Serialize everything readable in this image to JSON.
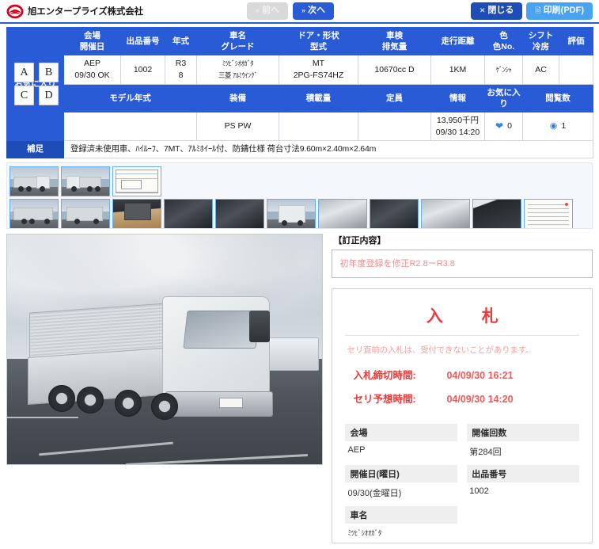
{
  "header": {
    "brand_name": "旭エンタープライズ株式会社",
    "logo_icon": "asahi-circle-logo",
    "prev_label": "前へ",
    "prev_glyph": "«",
    "next_label": "次へ",
    "next_glyph": "»",
    "close_label": "閉じる",
    "close_glyph": "✕",
    "print_label": "印刷(PDF)",
    "print_glyph": "🗎",
    "accent_blue": "#2a5bd7",
    "print_blue": "#4aa3f0"
  },
  "table": {
    "headers_row1": [
      "お気に入り",
      "会場\n開催日",
      "出品番号",
      "年式",
      "車名\nグレード",
      "ドア・形状\n型式",
      "車検\n排気量",
      "走行距離",
      "色\n色No.",
      "シフト\n冷房",
      "評価"
    ],
    "h_favorite": "お気に入り",
    "h_venue": "会場",
    "h_venue2": "開催日",
    "h_lot": "出品番号",
    "h_year": "年式",
    "h_name": "車名",
    "h_name2": "グレード",
    "h_door": "ドア・形状",
    "h_door2": "型式",
    "h_shaken": "車検",
    "h_shaken2": "排気量",
    "h_mileage": "走行距離",
    "h_color": "色",
    "h_color2": "色No.",
    "h_shift": "シフト",
    "h_shift2": "冷房",
    "h_rating": "評価",
    "fav_buttons": [
      "A",
      "B",
      "C",
      "D"
    ],
    "row1": {
      "venue": "AEP",
      "venue_date": "09/30 OK",
      "lot_no": "1002",
      "year": "R3",
      "year2": "8",
      "car_name": "ﾐﾂﾋﾞｼｵｵｶﾞﾀ",
      "grade": "三菱 ｱﾙﾐｳｲﾝｸﾞ",
      "door": "MT",
      "model_code": "2PG-FS74HZ",
      "displacement": "10670cc D",
      "mileage": "1KM",
      "color": "ｹﾞﾝｼｬ",
      "shift_ac": "AC",
      "rating": ""
    },
    "headers_row2": [
      "モデル年式",
      "装備",
      "積載量",
      "定員",
      "情報",
      "お気に入り",
      "閲覧数"
    ],
    "h_model_year": "モデル年式",
    "h_equipment": "装備",
    "h_capacity": "積載量",
    "h_seats": "定員",
    "h_info": "情報",
    "h_fav2": "お気に入り",
    "h_views": "閲覧数",
    "row2": {
      "model_year": "",
      "equipment": "PS PW",
      "capacity": "",
      "seats": "",
      "info_price": "13,950千円",
      "info_time": "09/30 14:20",
      "fav_count": "0",
      "fav_icon": "heart-icon",
      "view_count": "1",
      "view_icon": "eye-icon"
    },
    "supplement_label": "補足",
    "supplement_text": "登録済未使用車、ﾊｲﾙｰﾌ、7MT、ｱﾙﾐﾎｲｰﾙ付、防錆仕様 荷台寸法9.60m×2.40m×2.64m"
  },
  "thumbnails": {
    "row1": [
      {
        "name": "truck-front-right-quarter",
        "kind": "truck-a"
      },
      {
        "name": "truck-front-left-quarter",
        "kind": "truck-b"
      },
      {
        "name": "inspection-sheet-drawing",
        "kind": "doc"
      }
    ],
    "row2": [
      {
        "name": "truck-rear-left-side",
        "kind": "truck-c"
      },
      {
        "name": "truck-rear-quarter",
        "kind": "truck-d"
      },
      {
        "name": "cargo-bay-interior",
        "kind": "interior"
      },
      {
        "name": "undercarriage-wheels",
        "kind": "dark"
      },
      {
        "name": "chassis-underside",
        "kind": "dark"
      },
      {
        "name": "cab-front-close",
        "kind": "truck-e"
      },
      {
        "name": "side-panel-detail",
        "kind": "metal"
      },
      {
        "name": "engine-bay",
        "kind": "dark"
      },
      {
        "name": "fuel-tank-detail",
        "kind": "metal"
      },
      {
        "name": "cab-interior-seat",
        "kind": "interior2"
      },
      {
        "name": "inspection-certificate",
        "kind": "doc2"
      }
    ]
  },
  "main_photo": {
    "name": "main-vehicle-photo",
    "alt": "三菱ふそう スーパーグレート アルミウイング 大型トラック"
  },
  "correction": {
    "title": "【訂正内容】",
    "text": "初年度登録を修正R2.8ーR3.8"
  },
  "bid_panel": {
    "title": "入　札",
    "note": "セリ直前の入札は、受付できないことがあります。",
    "deadline_label": "入札締切時間:",
    "deadline_value": "04/09/30 16:21",
    "auction_label": "セリ予想時間:",
    "auction_value": "04/09/30 14:20",
    "title_color": "#ef3b3b",
    "meta": [
      {
        "key": "会場",
        "value": "AEP",
        "kana": false
      },
      {
        "key": "開催回数",
        "value": "第284回",
        "kana": false
      },
      {
        "key": "開催日(曜日)",
        "value": "09/30(金曜日)",
        "kana": false
      },
      {
        "key": "出品番号",
        "value": "1002",
        "kana": false
      },
      {
        "key": "車名",
        "value": "ﾐﾂﾋﾞｼｵｵｶﾞﾀ",
        "kana": true
      }
    ]
  }
}
